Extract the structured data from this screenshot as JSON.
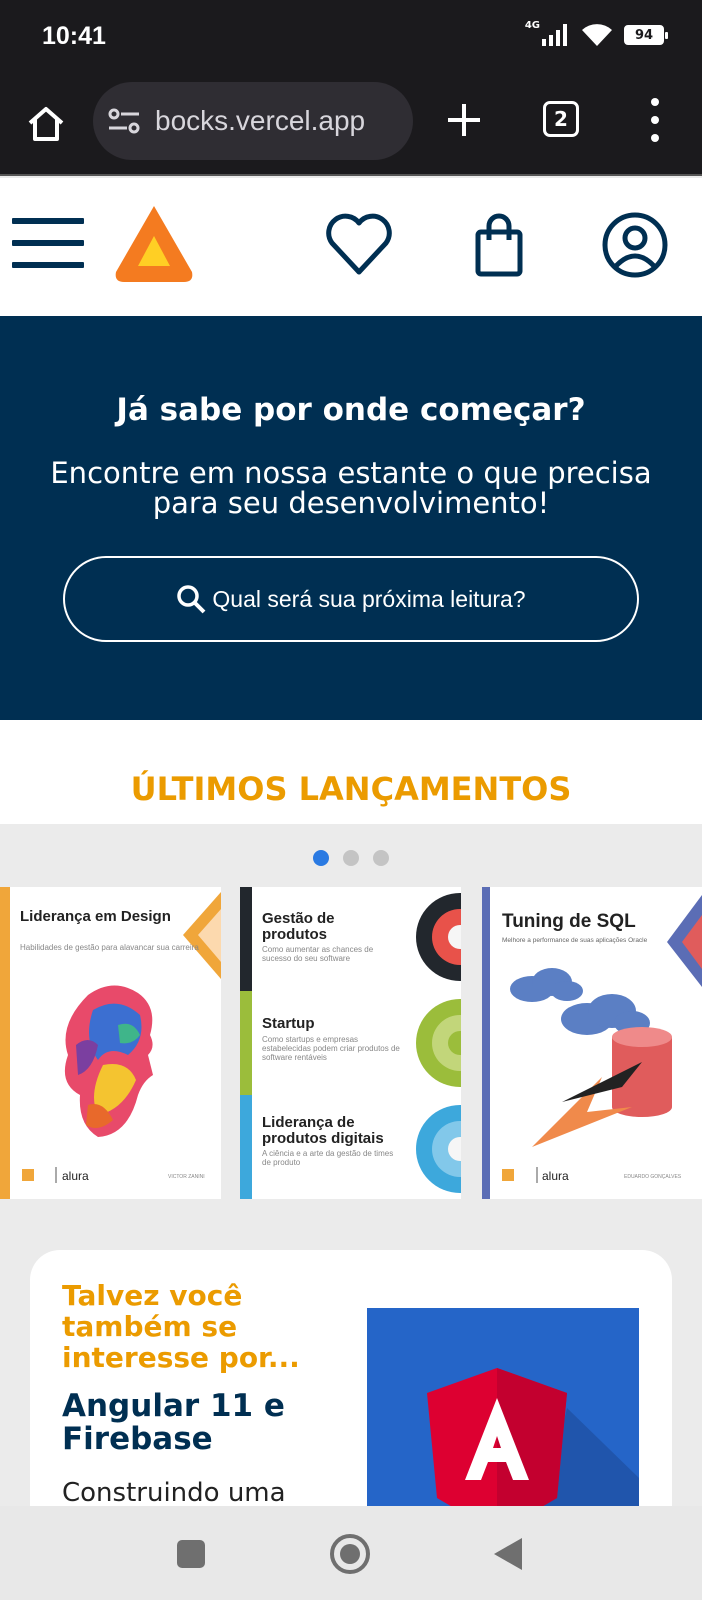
{
  "status": {
    "time": "10:41",
    "network": "4G",
    "battery": "94"
  },
  "browser": {
    "url": "bocks.vercel.app",
    "tab_count": "2"
  },
  "hero": {
    "title": "Já sabe por onde começar?",
    "subtitle": "Encontre em nossa estante o que precisa para seu desenvolvimento!",
    "search_placeholder": "Qual será sua próxima leitura?"
  },
  "releases": {
    "title": "ÚLTIMOS LANÇAMENTOS",
    "active_dot": 0,
    "dot_count": 3,
    "books": [
      {
        "title": "Liderança em Design",
        "subtitle": "Habilidades de gestão para alavancar sua carreira",
        "author": "VICTOR ZANINI",
        "publisher": "alura"
      },
      {
        "sections": [
          {
            "title": "Gestão de produtos",
            "subtitle": "Como aumentar as chances de sucesso do seu software"
          },
          {
            "title": "Startup",
            "subtitle": "Como startups e empresas estabelecidas podem criar produtos de software rentáveis"
          },
          {
            "title": "Liderança de produtos digitais",
            "subtitle": "A ciência e a arte da gestão de times de produto"
          }
        ]
      },
      {
        "title": "Tuning de SQL",
        "subtitle": "Melhore a performance de suas aplicações Oracle",
        "author": "EDUARDO GONÇALVES",
        "publisher": "alura"
      }
    ]
  },
  "suggestion": {
    "kicker": "Talvez você também se interesse por...",
    "title": "Angular 11 e Firebase",
    "description": "Construindo uma"
  },
  "colors": {
    "navy": "#002f52",
    "orange": "#eb9b00",
    "dot_active": "#2a7ae2"
  }
}
